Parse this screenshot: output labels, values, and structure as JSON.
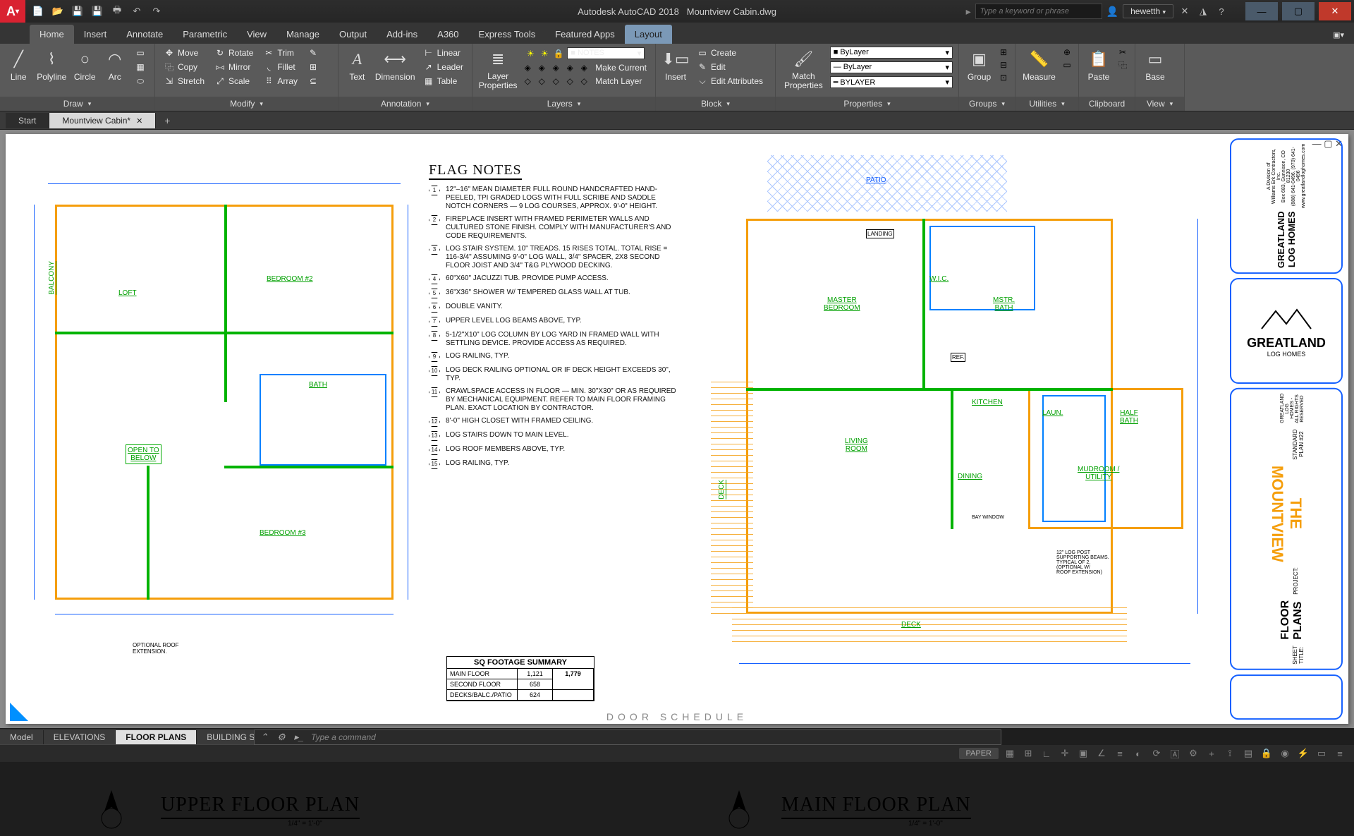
{
  "title": {
    "app": "Autodesk AutoCAD 2018",
    "file": "Mountview Cabin.dwg"
  },
  "search": {
    "placeholder": "Type a keyword or phrase"
  },
  "user": "hewetth",
  "menutabs": [
    "Home",
    "Insert",
    "Annotate",
    "Parametric",
    "View",
    "Manage",
    "Output",
    "Add-ins",
    "A360",
    "Express Tools",
    "Featured Apps",
    "Layout"
  ],
  "menutab_active": 0,
  "menutab_layout": 11,
  "ribbon": {
    "draw": {
      "label": "Draw",
      "line": "Line",
      "polyline": "Polyline",
      "circle": "Circle",
      "arc": "Arc"
    },
    "modify": {
      "label": "Modify",
      "move": "Move",
      "copy": "Copy",
      "stretch": "Stretch",
      "rotate": "Rotate",
      "mirror": "Mirror",
      "scale": "Scale",
      "trim": "Trim",
      "fillet": "Fillet",
      "array": "Array"
    },
    "annotation": {
      "label": "Annotation",
      "text": "Text",
      "dimension": "Dimension",
      "linear": "Linear",
      "leader": "Leader",
      "table": "Table"
    },
    "layers": {
      "label": "Layers",
      "properties": "Layer\nProperties",
      "combo": "NOTES"
    },
    "block": {
      "label": "Block",
      "insert": "Insert",
      "create": "Create",
      "edit": "Edit",
      "editattr": "Edit Attributes"
    },
    "properties": {
      "label": "Properties",
      "match": "Match\nProperties",
      "layer": "ByLayer",
      "ltype": "ByLayer",
      "lweight": "BYLAYER"
    },
    "groups": {
      "label": "Groups",
      "group": "Group"
    },
    "utilities": {
      "label": "Utilities",
      "measure": "Measure"
    },
    "clipboard": {
      "label": "Clipboard",
      "paste": "Paste"
    },
    "view": {
      "label": "View",
      "base": "Base"
    }
  },
  "filetabs": {
    "start": "Start",
    "active": "Mountview Cabin*"
  },
  "layouttabs": [
    "Model",
    "ELEVATIONS",
    "FLOOR PLANS",
    "BUILDING SECTION & NOTES"
  ],
  "layouttab_active": 2,
  "cmd": {
    "placeholder": "Type a command"
  },
  "status": {
    "paper": "PAPER"
  },
  "plans": {
    "upper": {
      "title": "UPPER FLOOR PLAN",
      "scale": "1/4\" = 1'-0\"",
      "rooms": {
        "loft": "LOFT",
        "bed2": "BEDROOM #2",
        "bath": "BATH",
        "bed3": "BEDROOM #3",
        "open": "OPEN TO\nBELOW",
        "balcony": "BALCONY"
      },
      "ext_note": "OPTIONAL ROOF\nEXTENSION."
    },
    "main": {
      "title": "MAIN FLOOR PLAN",
      "scale": "1/4\" = 1'-0\"",
      "rooms": {
        "patio": "PATIO",
        "landing": "LANDING",
        "master": "MASTER\nBEDROOM",
        "wic": "W.I.C.",
        "mbath": "MSTR.\nBATH",
        "kitchen": "KITCHEN",
        "living": "LIVING\nROOM",
        "dining": "DINING",
        "laun": "LAUN.",
        "half": "HALF\nBATH",
        "mud": "MUDROOM /\nUTILITY",
        "deckL": "DECK",
        "deckB": "DECK",
        "bay": "BAY WINDOW",
        "ref": "REF."
      },
      "post_note": "12\" LOG POST\nSUPPORTING BEAMS.\nTYPICAL OF 2.\n(OPTIONAL W/\nROOF EXTENSION)"
    }
  },
  "notes": {
    "title": "FLAG NOTES",
    "items": [
      "12\"–16\" MEAN DIAMETER FULL ROUND HANDCRAFTED HAND-PEELED, TPI GRADED LOGS WITH FULL SCRIBE AND SADDLE NOTCH CORNERS — 9 LOG COURSES, APPROX. 9'-0\" HEIGHT.",
      "FIREPLACE INSERT WITH FRAMED PERIMETER WALLS AND CULTURED STONE FINISH. COMPLY WITH MANUFACTURER'S AND CODE REQUIREMENTS.",
      "LOG STAIR SYSTEM. 10\" TREADS. 15 RISES TOTAL. TOTAL RISE = 116-3/4\" ASSUMING 9'-0\" LOG WALL, 3/4\" SPACER, 2x8 SECOND FLOOR JOIST AND 3/4\" T&G PLYWOOD DECKING.",
      "60\"x60\" JACUZZI TUB. PROVIDE PUMP ACCESS.",
      "36\"x36\" SHOWER w/ TEMPERED GLASS WALL AT TUB.",
      "DOUBLE VANITY.",
      "UPPER LEVEL LOG BEAMS ABOVE, TYP.",
      "5-1/2\"x10\" LOG COLUMN BY LOG YARD IN FRAMED WALL WITH SETTLING DEVICE. PROVIDE ACCESS AS REQUIRED.",
      "LOG RAILING, TYP.",
      "LOG DECK RAILING OPTIONAL OR IF DECK HEIGHT EXCEEDS 30\", TYP.",
      "CRAWLSPACE ACCESS IN FLOOR — MIN. 30\"x30\" OR AS REQUIRED BY MECHANICAL EQUIPMENT. REFER TO MAIN FLOOR FRAMING PLAN. EXACT LOCATION BY CONTRACTOR.",
      "8'-0\" HIGH CLOSET WITH FRAMED CEILING.",
      "LOG STAIRS DOWN TO MAIN LEVEL.",
      "LOG ROOF MEMBERS ABOVE, TYP.",
      "LOG RAILING, TYP."
    ]
  },
  "sq": {
    "title": "SQ FOOTAGE SUMMARY",
    "rows": [
      {
        "k": "MAIN FLOOR",
        "v": "1,121"
      },
      {
        "k": "SECOND FLOOR",
        "v": "658"
      },
      {
        "k": "DECKS/BALC./PATIO",
        "v": "624"
      }
    ],
    "total": "1,779"
  },
  "titleblock": {
    "company": "GREATLAND LOG HOMES",
    "company_sub": "A Division of\nWilliams Erk Contractors, Inc.\nBox 683, Gunnison, CO 81230\n(888) 641-0496, (970) 641-0496\nwww.greatlandloghomes.com",
    "logo": "GREATLAND",
    "logo_sub": "LOG HOMES",
    "sheet_title_label": "SHEET TITLE:",
    "sheet_title": "FLOOR PLANS",
    "project_label": "PROJECT:",
    "project": "THE MOUNTVIEW",
    "plan_no": "STANDARD PLAN #22",
    "rights": "GREATLAND LOG HOMES - ALL RIGHTS RESERVED"
  },
  "door_schedule": "DOOR SCHEDULE"
}
